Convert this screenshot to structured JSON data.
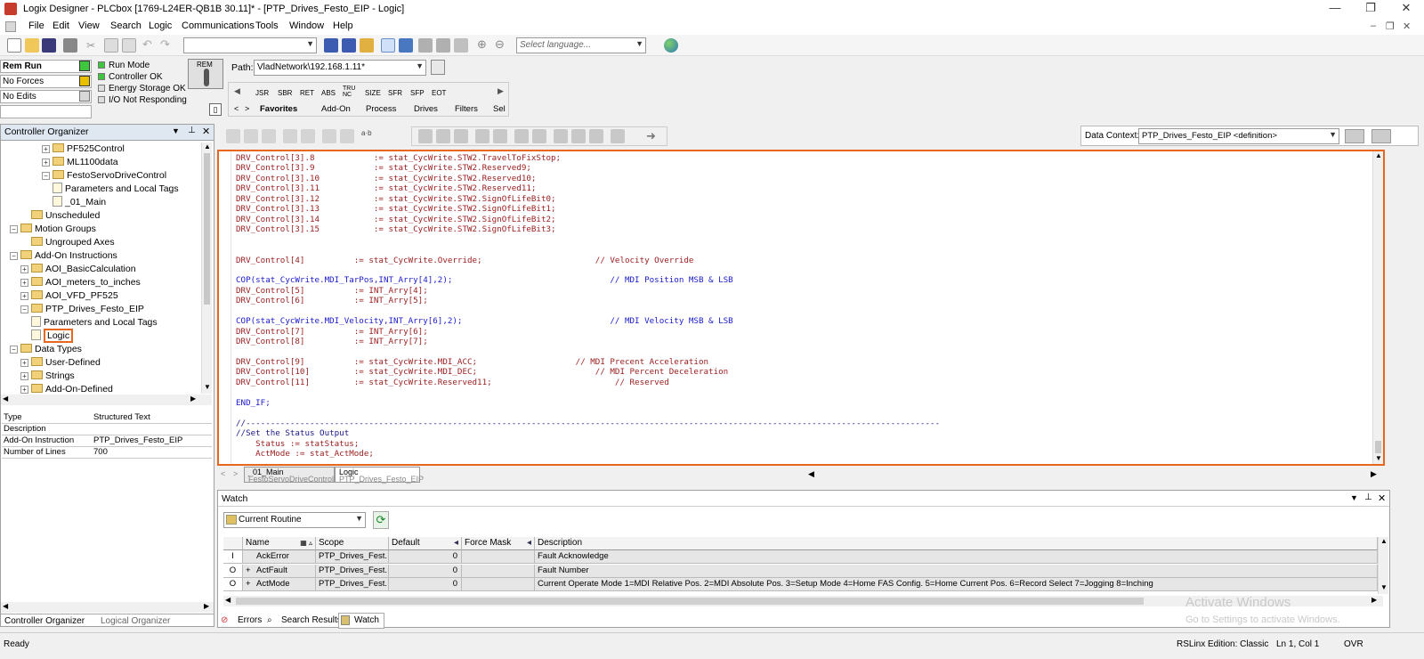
{
  "window": {
    "title": "Logix Designer - PLCbox [1769-L24ER-QB1B 30.11]* - [PTP_Drives_Festo_EIP - Logic]",
    "min": "—",
    "max": "❐",
    "close": "✕"
  },
  "menu": [
    "File",
    "Edit",
    "View",
    "Search",
    "Logic",
    "Communications",
    "Tools",
    "Window",
    "Help"
  ],
  "toolbar": {
    "language_placeholder": "Select language...",
    "path_label": "Path:",
    "path_value": "VladNetwork\\192.168.1.11*"
  },
  "controller_status": {
    "mode": "Rem Run",
    "forces": "No Forces",
    "edits": "No Edits",
    "indicators": [
      "Run Mode",
      "Controller OK",
      "Energy Storage OK",
      "I/O Not Responding"
    ],
    "keyswitch": "REM"
  },
  "instructions": {
    "items": [
      "JSR",
      "SBR",
      "RET",
      "ABS",
      "TRU NC",
      "SIZE",
      "SFR",
      "SFP",
      "EOT"
    ],
    "tabs": [
      "Favorites",
      "Add-On",
      "Process",
      "Drives",
      "Filters",
      "Sel"
    ]
  },
  "organizer": {
    "title": "Controller Organizer",
    "tree": [
      {
        "label": "PF525Control",
        "level": 3,
        "type": "folder",
        "exp": "+"
      },
      {
        "label": "ML1100data",
        "level": 3,
        "type": "folder",
        "exp": "+"
      },
      {
        "label": "FestoServoDriveControl",
        "level": 3,
        "type": "folder",
        "exp": "−"
      },
      {
        "label": "Parameters and Local Tags",
        "level": 4,
        "type": "doc"
      },
      {
        "label": "_01_Main",
        "level": 4,
        "type": "doc"
      },
      {
        "label": "Unscheduled",
        "level": 2,
        "type": "folder"
      },
      {
        "label": "Motion Groups",
        "level": 0,
        "type": "folder",
        "exp": "−"
      },
      {
        "label": "Ungrouped Axes",
        "level": 2,
        "type": "folder"
      },
      {
        "label": "Add-On Instructions",
        "level": 0,
        "type": "folder",
        "exp": "−"
      },
      {
        "label": "AOI_BasicCalculation",
        "level": 1,
        "type": "folder",
        "exp": "+"
      },
      {
        "label": "AOI_meters_to_inches",
        "level": 1,
        "type": "folder",
        "exp": "+"
      },
      {
        "label": "AOI_VFD_PF525",
        "level": 1,
        "type": "folder",
        "exp": "+"
      },
      {
        "label": "PTP_Drives_Festo_EIP",
        "level": 1,
        "type": "folder",
        "exp": "−"
      },
      {
        "label": "Parameters and Local Tags",
        "level": 2,
        "type": "doc"
      },
      {
        "label": "Logic",
        "level": 2,
        "type": "doc",
        "selected": true
      },
      {
        "label": "Data Types",
        "level": 0,
        "type": "folder",
        "exp": "−"
      },
      {
        "label": "User-Defined",
        "level": 1,
        "type": "folder",
        "exp": "+"
      },
      {
        "label": "Strings",
        "level": 1,
        "type": "folder",
        "exp": "+"
      },
      {
        "label": "Add-On-Defined",
        "level": 1,
        "type": "folder",
        "exp": "+"
      }
    ],
    "properties": [
      {
        "k": "Type",
        "v": "Structured Text"
      },
      {
        "k": "Description",
        "v": ""
      },
      {
        "k": "Add-On Instruction",
        "v": "PTP_Drives_Festo_EIP"
      },
      {
        "k": "Number of Lines",
        "v": "700"
      }
    ],
    "bottom_tabs": [
      "Controller Organizer",
      "Logical Organizer"
    ]
  },
  "data_context": {
    "label": "Data Context:",
    "value": "PTP_Drives_Festo_EIP <definition>"
  },
  "code_lines": [
    {
      "t": "DRV_Control[3].8            := stat_CycWrite.STW2.TravelToFixStop;",
      "c": "pl"
    },
    {
      "t": "DRV_Control[3].9            := stat_CycWrite.STW2.Reserved9;",
      "c": "pl"
    },
    {
      "t": "DRV_Control[3].10           := stat_CycWrite.STW2.Reserved10;",
      "c": "pl"
    },
    {
      "t": "DRV_Control[3].11           := stat_CycWrite.STW2.Reserved11;",
      "c": "pl"
    },
    {
      "t": "DRV_Control[3].12           := stat_CycWrite.STW2.SignOfLifeBit0;",
      "c": "pl"
    },
    {
      "t": "DRV_Control[3].13           := stat_CycWrite.STW2.SignOfLifeBit1;",
      "c": "pl"
    },
    {
      "t": "DRV_Control[3].14           := stat_CycWrite.STW2.SignOfLifeBit2;",
      "c": "pl"
    },
    {
      "t": "DRV_Control[3].15           := stat_CycWrite.STW2.SignOfLifeBit3;",
      "c": "pl"
    },
    {
      "t": "",
      "c": "pl"
    },
    {
      "t": "",
      "c": "pl"
    },
    {
      "t": "DRV_Control[4]          := stat_CycWrite.Override;                       // Velocity Override",
      "c": "pl"
    },
    {
      "t": "",
      "c": "pl"
    },
    {
      "t": "COP(stat_CycWrite.MDI_TarPos,INT_Arry[4],2);                                // MDI Position MSB & LSB",
      "c": "kw"
    },
    {
      "t": "DRV_Control[5]          := INT_Arry[4];",
      "c": "pl"
    },
    {
      "t": "DRV_Control[6]          := INT_Arry[5];",
      "c": "pl"
    },
    {
      "t": "",
      "c": "pl"
    },
    {
      "t": "COP(stat_CycWrite.MDI_Velocity,INT_Arry[6],2);                              // MDI Velocity MSB & LSB",
      "c": "kw"
    },
    {
      "t": "DRV_Control[7]          := INT_Arry[6];",
      "c": "pl"
    },
    {
      "t": "DRV_Control[8]          := INT_Arry[7];",
      "c": "pl"
    },
    {
      "t": "",
      "c": "pl"
    },
    {
      "t": "DRV_Control[9]          := stat_CycWrite.MDI_ACC;                    // MDI Precent Acceleration",
      "c": "pl"
    },
    {
      "t": "DRV_Control[10]         := stat_CycWrite.MDI_DEC;                        // MDI Percent Deceleration",
      "c": "pl"
    },
    {
      "t": "DRV_Control[11]         := stat_CycWrite.Reserved11;                         // Reserved",
      "c": "pl"
    },
    {
      "t": "",
      "c": "pl"
    },
    {
      "t": "END_IF;",
      "c": "kw"
    },
    {
      "t": "",
      "c": "pl"
    },
    {
      "t": "//---------------------------------------------------------------------------------------------------------------------------------------------",
      "c": "cm"
    },
    {
      "t": "//Set the Status Output",
      "c": "cm"
    },
    {
      "t": "    Status := statStatus;",
      "c": "pl"
    },
    {
      "t": "    ActMode := stat_ActMode;",
      "c": "pl"
    }
  ],
  "routine_tabs": [
    {
      "name": "_01_Main",
      "sub": "FestoServoDriveControl"
    },
    {
      "name": "Logic",
      "sub": "PTP_Drives_Festo_EIP"
    }
  ],
  "watch": {
    "title": "Watch",
    "scope_select": "Current Routine",
    "columns": [
      "Name",
      "Scope",
      "Default",
      "Force Mask",
      "Description"
    ],
    "rows": [
      {
        "io": "I",
        "exp": "",
        "name": "AckError",
        "scope": "PTP_Drives_Fest...",
        "default": "0",
        "force": "",
        "desc": "Fault Acknowledge"
      },
      {
        "io": "O",
        "exp": "+",
        "name": "ActFault",
        "scope": "PTP_Drives_Fest...",
        "default": "0",
        "force": "",
        "desc": "Fault Number"
      },
      {
        "io": "O",
        "exp": "+",
        "name": "ActMode",
        "scope": "PTP_Drives_Fest...",
        "default": "0",
        "force": "",
        "desc": "Current Operate Mode 1=MDI Relative Pos. 2=MDI Absolute Pos. 3=Setup Mode 4=Home FAS Config. 5=Home Current Pos. 6=Record Select 7=Jogging 8=Inching"
      }
    ],
    "bottom_tabs": [
      "Errors",
      "Search Results",
      "Watch"
    ]
  },
  "watermark": {
    "line1": "Activate Windows",
    "line2": "Go to Settings to activate Windows."
  },
  "status": {
    "left": "Ready",
    "edition": "RSLinx Edition: Classic",
    "position": "Ln 1, Col 1",
    "ovr": "OVR"
  }
}
